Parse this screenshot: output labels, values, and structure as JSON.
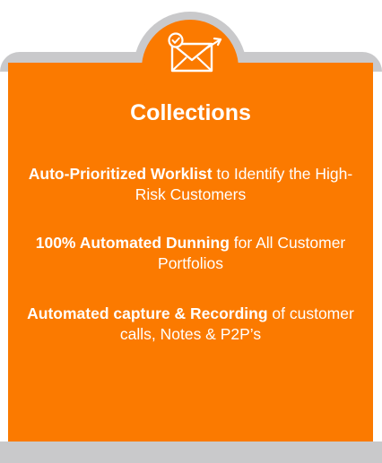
{
  "card": {
    "title": "Collections",
    "accent_color": "#fb7a00",
    "frame_color": "#c9c9cb",
    "icon": "email-check-icon"
  },
  "features": [
    {
      "bold": "Auto-Prioritized Worklist",
      "rest": " to Identify the High-Risk Customers"
    },
    {
      "bold": "100% Automated Dunning",
      "rest": " for All Customer Portfolios"
    },
    {
      "bold": "Automated capture & Recording",
      "rest": " of customer calls, Notes & P2P’s"
    }
  ]
}
